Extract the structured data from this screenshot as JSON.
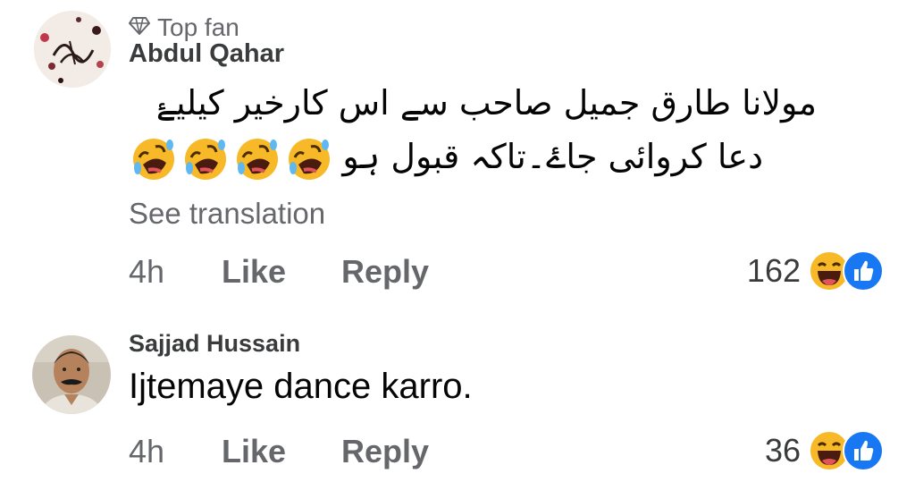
{
  "comments": [
    {
      "badge": "Top fan",
      "author": "Abdul Qahar",
      "text_line1": "مولانا طارق جمیل صاحب سے اس کارخیر کیلیۓ",
      "text_line2": "دعا کروائی جاۓ۔تاکہ قبول ہو",
      "emoji_count": 4,
      "emoji": "rolling-on-floor-laughing",
      "see_translation": "See translation",
      "time": "4h",
      "like_label": "Like",
      "reply_label": "Reply",
      "reaction_count": "162",
      "reaction_icons": [
        "haha-icon",
        "like-icon"
      ]
    },
    {
      "author": "Sajjad Hussain",
      "text": "Ijtemaye dance karro.",
      "time": "4h",
      "like_label": "Like",
      "reply_label": "Reply",
      "reaction_count": "36",
      "reaction_icons": [
        "haha-icon",
        "like-icon"
      ]
    }
  ],
  "colors": {
    "secondary_text": "#65676b",
    "like_blue": "#1877f2",
    "haha_yellow": "#f7b928"
  }
}
